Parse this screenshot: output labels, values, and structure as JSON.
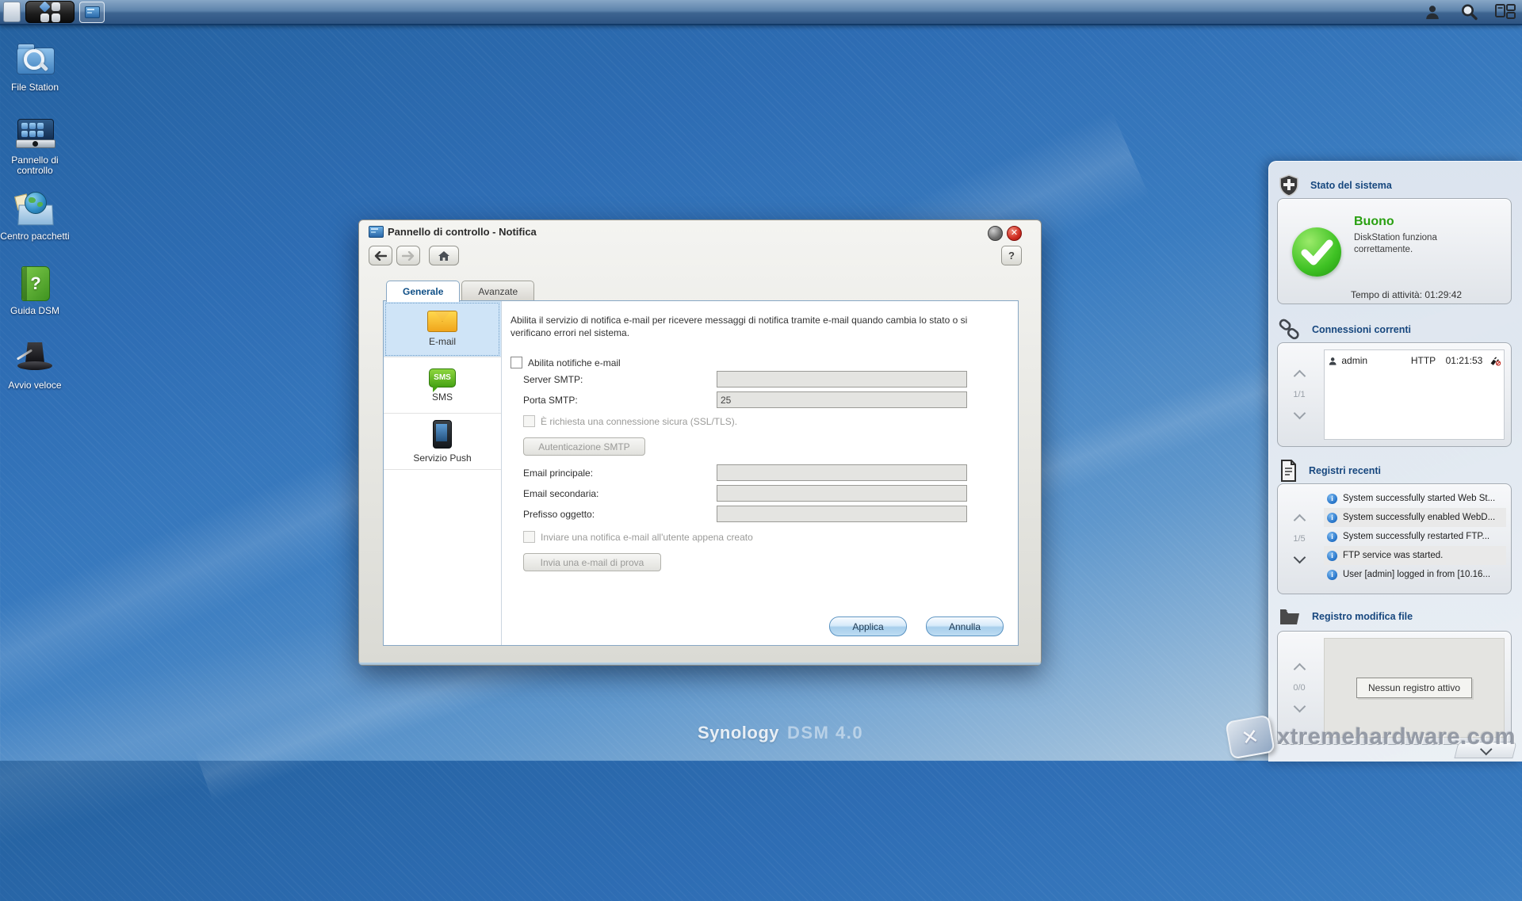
{
  "desktop_icons": [
    {
      "label": "File Station"
    },
    {
      "label": "Pannello di controllo"
    },
    {
      "label": "Centro pacchetti"
    },
    {
      "label": "Guida DSM"
    },
    {
      "label": "Avvio veloce"
    }
  ],
  "window": {
    "title": "Pannello di controllo - Notifica",
    "close_glyph": "✕",
    "help_label": "?",
    "tabs": [
      {
        "label": "Generale"
      },
      {
        "label": "Avanzate"
      }
    ],
    "sidebar": [
      {
        "label": "E-mail"
      },
      {
        "label": "SMS"
      },
      {
        "label": "Servizio Push"
      }
    ],
    "sms_icon_text": "SMS",
    "form": {
      "description": "Abilita il servizio di notifica e-mail per ricevere messaggi di notifica tramite e-mail quando cambia lo stato o si verificano errori nel sistema.",
      "enable_checkbox": "Abilita notifiche e-mail",
      "server_label": "Server SMTP:",
      "server_value": "",
      "port_label": "Porta SMTP:",
      "port_value": "25",
      "ssl_checkbox": "È richiesta una connessione sicura (SSL/TLS).",
      "auth_button": "Autenticazione SMTP",
      "email1_label": "Email principale:",
      "email1_value": "",
      "email2_label": "Email secondaria:",
      "email2_value": "",
      "prefix_label": "Prefisso oggetto:",
      "prefix_value": "",
      "notify_checkbox": "Inviare una notifica e-mail all'utente appena creato",
      "test_button": "Invia una e-mail di prova",
      "apply_button": "Applica",
      "cancel_button": "Annulla"
    }
  },
  "widgets": {
    "system_status": {
      "title": "Stato del sistema",
      "status": "Buono",
      "status_color": "#2aa012",
      "message": "DiskStation funziona correttamente.",
      "uptime": "Tempo di attività: 01:29:42"
    },
    "connections": {
      "title": "Connessioni correnti",
      "pager": "1/1",
      "rows": [
        {
          "user": "admin",
          "protocol": "HTTP",
          "time": "01:21:53"
        }
      ]
    },
    "recent_logs": {
      "title": "Registri recenti",
      "pager": "1/5",
      "items": [
        "System successfully started Web St...",
        "System successfully enabled WebD...",
        "System successfully restarted FTP...",
        "FTP service was started.",
        "User [admin] logged in from [10.16..."
      ]
    },
    "file_log": {
      "title": "Registro modifica file",
      "pager": "0/0",
      "empty": "Nessun registro attivo"
    }
  },
  "footer": {
    "brand": "Synology",
    "version": "DSM 4.0",
    "watermark_x": "✕",
    "watermark": "xtremehardware.com"
  }
}
